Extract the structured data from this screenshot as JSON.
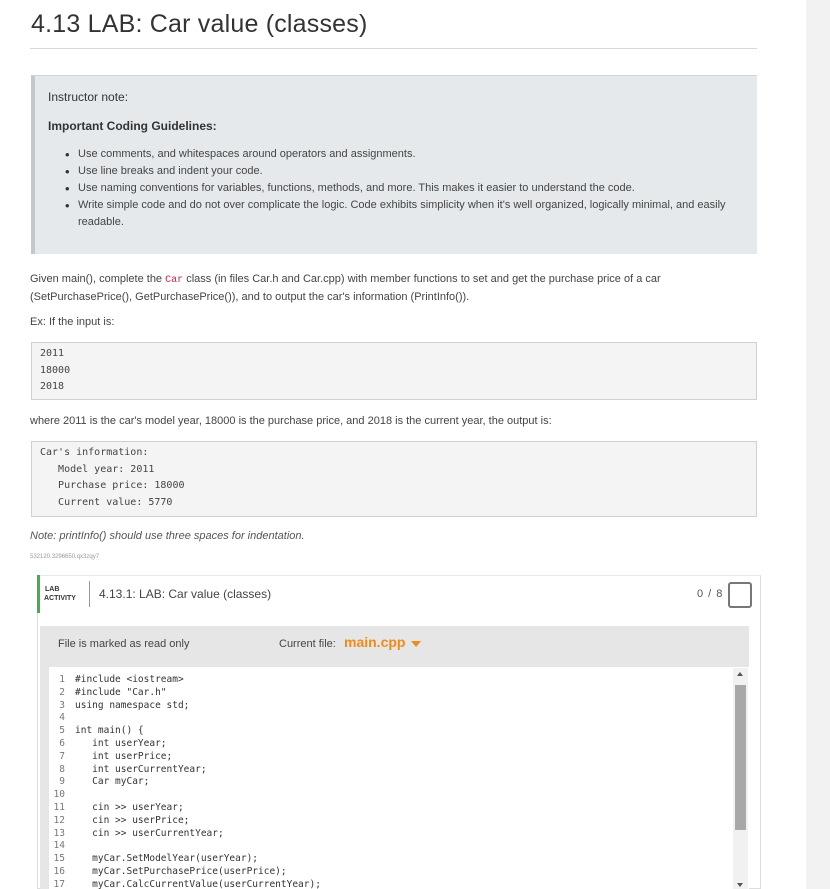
{
  "page": {
    "title": "4.13 LAB: Car value (classes)"
  },
  "instructor_note": {
    "title": "Instructor note:",
    "heading": "Important Coding Guidelines:",
    "items": [
      "Use comments, and whitespaces around operators and assignments.",
      "Use line breaks and indent your code.",
      "Use naming conventions for variables, functions, methods, and more. This makes it easier to understand the code.",
      "Write simple code and do not over complicate the logic. Code exhibits simplicity when it's well organized, logically minimal, and easily readable."
    ]
  },
  "description": {
    "intro_before": "Given main(), complete the ",
    "intro_code": "Car",
    "intro_after": " class (in files Car.h and Car.cpp) with member functions to set and get the purchase price of a car (SetPurchasePrice(), GetPurchasePrice()), and to output the car's information (PrintInfo()).",
    "example_label": "Ex: If the input is:",
    "input_lines": [
      "2011",
      "18000",
      "2018"
    ],
    "where_text": "where 2011 is the car's model year, 18000 is the purchase price, and 2018 is the current year, the output is:",
    "output_lines": [
      "Car's information:",
      "   Model year: 2011",
      "   Purchase price: 18000",
      "   Current value: 5770"
    ],
    "note": "Note: printInfo() should use three spaces for indentation.",
    "id_text": "532120.3296650.qx3zqy7"
  },
  "lab": {
    "tag_line1": "LAB",
    "tag_line2": "ACTIVITY",
    "title": "4.13.1: LAB: Car value (classes)",
    "score": "0 / 8",
    "readonly_label": "File is marked as read only",
    "current_file_label": "Current file:",
    "current_file": "main.cpp",
    "code_lines": [
      "#include <iostream>",
      "#include \"Car.h\"",
      "using namespace std;",
      "",
      "int main() {",
      "   int userYear;",
      "   int userPrice;",
      "   int userCurrentYear;",
      "   Car myCar;",
      "",
      "   cin >> userYear;",
      "   cin >> userPrice;",
      "   cin >> userCurrentYear;",
      "",
      "   myCar.SetModelYear(userYear);",
      "   myCar.SetPurchasePrice(userPrice);",
      "   myCar.CalcCurrentValue(userCurrentYear);"
    ]
  },
  "colors": {
    "accent_orange": "#f08a1c",
    "lab_green": "#3bb34a",
    "note_bg": "#e6e9ec"
  },
  "icons": {
    "file_dropdown": "caret-down-icon",
    "score_box": "checkbox-icon"
  }
}
